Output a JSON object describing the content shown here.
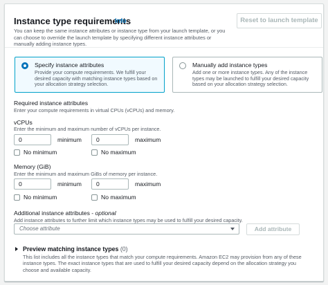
{
  "header": {
    "title": "Instance type requirements",
    "info": "Info",
    "reset_label": "Reset to launch template",
    "description": "You can keep the same instance attributes or instance type from your launch template, or you can choose to override the launch template by specifying different instance attributes or manually adding instance types."
  },
  "options": {
    "specify": {
      "title": "Specify instance attributes",
      "description": "Provide your compute requirements. We fulfill your desired capacity with matching instance types based on your allocation strategy selection.",
      "selected": true
    },
    "manual": {
      "title": "Manually add instance types",
      "description": "Add one or more instance types. Any of the instance types may be launched to fulfill your desired capacity based on your allocation strategy selection.",
      "selected": false
    }
  },
  "required": {
    "title": "Required instance attributes",
    "description": "Enter your compute requirements in virtual CPUs (vCPUs) and memory."
  },
  "vcpus": {
    "label": "vCPUs",
    "description": "Enter the minimum and maximum number of vCPUs per instance.",
    "min_value": "0",
    "min_label": "minimum",
    "max_value": "0",
    "max_label": "maximum",
    "no_min": "No minimum",
    "no_max": "No maximum"
  },
  "memory": {
    "label": "Memory (GiB)",
    "description": "Enter the minimum and maximum GiBs of memory per instance.",
    "min_value": "0",
    "min_label": "minimum",
    "max_value": "0",
    "max_label": "maximum",
    "no_min": "No minimum",
    "no_max": "No maximum"
  },
  "additional": {
    "title": "Additional instance attributes",
    "optional": "optional",
    "description": "Add instance attributes to further limit which instance types may be used to fulfill your desired capacity.",
    "placeholder": "Choose attribute",
    "add_label": "Add attribute"
  },
  "preview": {
    "title": "Preview matching instance types",
    "count": "(0)",
    "description": "This list includes all the instance types that match your compute requirements. Amazon EC2 may provision from any of these instance types. The exact instance types that are used to fulfill your desired capacity depend on the allocation strategy you choose and available capacity."
  }
}
